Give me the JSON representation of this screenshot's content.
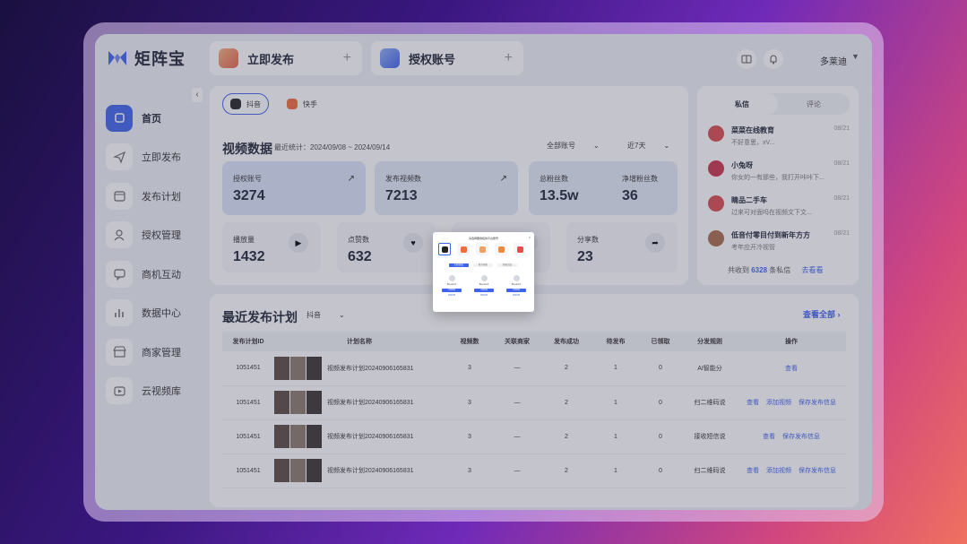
{
  "app": {
    "name": "矩阵宝",
    "brand_color": "#3f63ea"
  },
  "sidebar": {
    "items": [
      {
        "label": "首页",
        "icon": "home-icon",
        "active": true
      },
      {
        "label": "立即发布",
        "icon": "send-icon"
      },
      {
        "label": "发布计划",
        "icon": "calendar-icon"
      },
      {
        "label": "授权管理",
        "icon": "user-auth-icon"
      },
      {
        "label": "商机互动",
        "icon": "chat-icon"
      },
      {
        "label": "数据中心",
        "icon": "chart-icon"
      },
      {
        "label": "商家管理",
        "icon": "store-icon"
      },
      {
        "label": "云视频库",
        "icon": "video-library-icon"
      }
    ]
  },
  "header": {
    "publish_label": "立即发布",
    "auth_label": "授权账号",
    "user_name": "多莱迪"
  },
  "platforms": [
    "抖音",
    "快手"
  ],
  "stats": {
    "title": "视频数据",
    "range_label": "最近统计：2024/09/08 ~ 2024/09/14",
    "account_select": "全部账号",
    "period_select": "近7天",
    "cards": [
      {
        "label": "授权账号",
        "value": "3274"
      },
      {
        "label": "发布视频数",
        "value": "7213"
      },
      {
        "label": "总粉丝数",
        "value": "13.5w"
      },
      {
        "label": "净增粉丝数",
        "value": "36"
      },
      {
        "label": "播放量",
        "value": "1432"
      },
      {
        "label": "点赞数",
        "value": "632"
      },
      {
        "label": "分享数",
        "value": "23"
      }
    ]
  },
  "messages": {
    "tabs": [
      "私信",
      "评论"
    ],
    "items": [
      {
        "name": "菜菜在线教育",
        "text": "不好意思，xV...",
        "date": "08/21",
        "color": "#d94a4a"
      },
      {
        "name": "小兔呀",
        "text": "你女的一有那些，我打开咔咔下...",
        "date": "08/21",
        "color": "#c9324a"
      },
      {
        "name": "睛品二手车",
        "text": "过来可对面吗在视频文下文...",
        "date": "08/21",
        "color": "#d94a4a"
      },
      {
        "name": "低音付零目付到新年方方",
        "text": "考年应开冷视管",
        "date": "08/21",
        "color": "#a86a4a"
      }
    ],
    "footer_prefix": "共收到",
    "footer_count": "6328",
    "footer_suffix": "条私信",
    "footer_link": "去看看"
  },
  "plans": {
    "title": "最近发布计划",
    "platform_select": "抖音",
    "view_all": "查看全部",
    "columns": [
      "发布计划ID",
      "计划名称",
      "视频数",
      "关联商家",
      "发布成功",
      "待发布",
      "已领取",
      "分发规则",
      "操作"
    ],
    "rows": [
      {
        "id": "1051451",
        "name": "视频发布计划20240906165831",
        "videos": "3",
        "merchant": "—",
        "success": "2",
        "pending": "1",
        "claimed": "0",
        "rule": "AI智能分",
        "ops": [
          "查看"
        ]
      },
      {
        "id": "1051451",
        "name": "视频发布计划20240906165831",
        "videos": "3",
        "merchant": "—",
        "success": "2",
        "pending": "1",
        "claimed": "0",
        "rule": "扫二维码说",
        "ops": [
          "查看",
          "添加视频",
          "保存发布信息"
        ]
      },
      {
        "id": "1051451",
        "name": "视频发布计划20240906165831",
        "videos": "3",
        "merchant": "—",
        "success": "2",
        "pending": "1",
        "claimed": "0",
        "rule": "接收短信说",
        "ops": [
          "查看",
          "保存发布信息"
        ]
      },
      {
        "id": "1051451",
        "name": "视频发布计划20240906165831",
        "videos": "3",
        "merchant": "—",
        "success": "2",
        "pending": "1",
        "claimed": "0",
        "rule": "扫二维码说",
        "ops": [
          "查看",
          "添加视频",
          "保存发布信息"
        ]
      }
    ]
  },
  "modal": {
    "title": "请选择要授权的平台账号",
    "close": "×",
    "platforms": [
      {
        "icon": "douyin-icon",
        "color": "#222222"
      },
      {
        "icon": "kuaishou-icon",
        "color": "#f26b3a"
      },
      {
        "icon": "xiaohongshu-icon",
        "color": "#f0a060"
      },
      {
        "icon": "shipinhao-icon",
        "color": "#f08a3a"
      },
      {
        "icon": "bilibili-icon",
        "color": "#e94a4a"
      }
    ],
    "steps": [
      "扫码授权",
      "账号授权",
      "授权完成"
    ],
    "accounts": [
      {
        "text": "Bluetooth",
        "btn": "立即授权",
        "link": "授权说明"
      },
      {
        "text": "Bluetooth",
        "btn": "立即授权",
        "link": "授权说明"
      },
      {
        "text": "Bluetooth",
        "btn": "立即授权",
        "link": "授权说明"
      }
    ]
  }
}
